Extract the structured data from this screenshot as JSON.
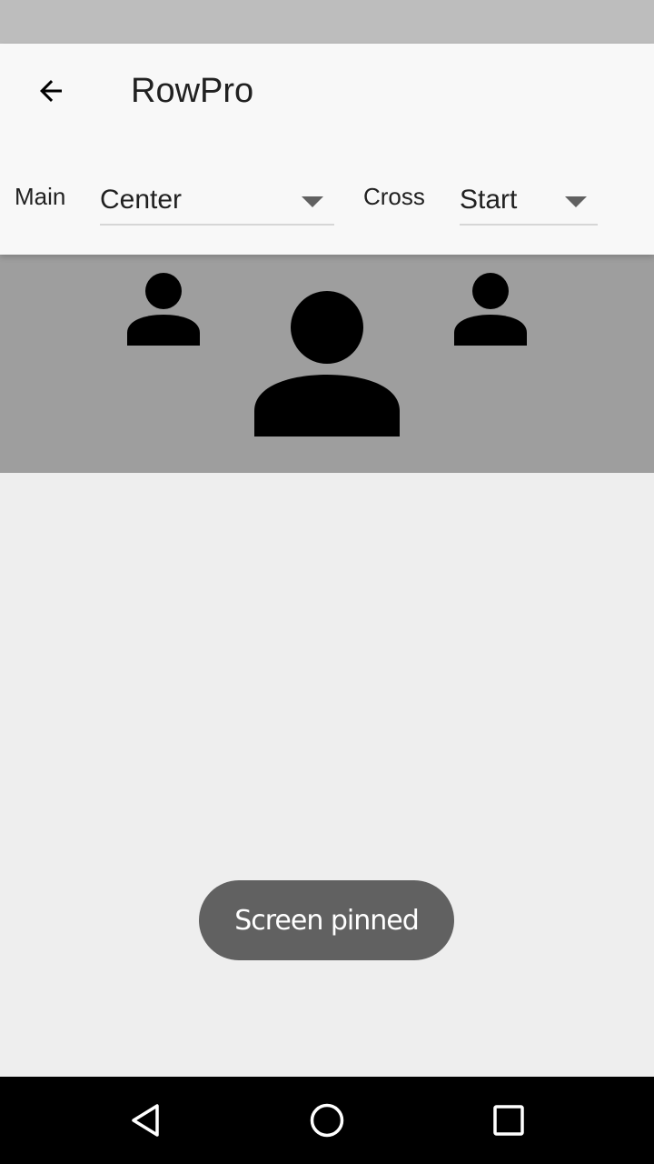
{
  "app_bar": {
    "title": "RowPro",
    "back_icon": "arrow-back-icon"
  },
  "controls": {
    "main_label": "Main",
    "main_value": "Center",
    "cross_label": "Cross",
    "cross_value": "Start"
  },
  "row": {
    "icons": [
      "person-icon",
      "person-icon",
      "person-icon"
    ]
  },
  "toast": {
    "text": "Screen pinned"
  },
  "nav": {
    "back": "nav-back-icon",
    "home": "nav-home-icon",
    "recents": "nav-recents-icon"
  },
  "colors": {
    "status_bar": "#bdbdbd",
    "app_bar": "#f8f8f8",
    "row_bg": "#9e9e9e",
    "page_bg": "#eeeeee",
    "toast_bg": "#616161",
    "nav_bg": "#000000"
  }
}
